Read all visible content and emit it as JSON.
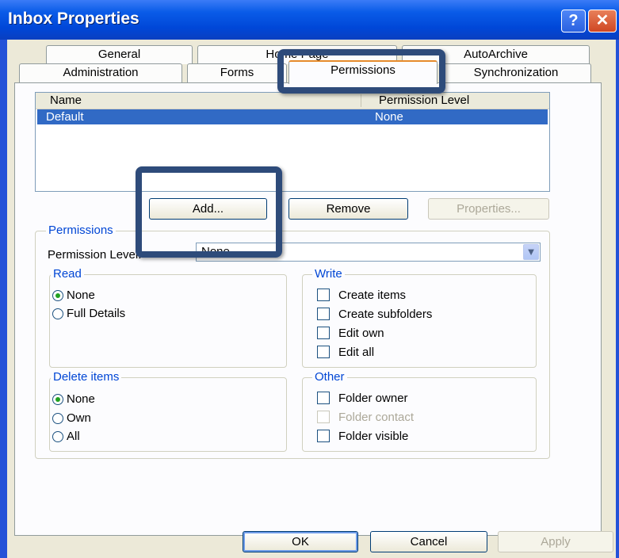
{
  "window": {
    "title": "Inbox Properties",
    "help_label": "?",
    "close_label": "✕"
  },
  "tabs": {
    "row1": [
      {
        "label": "General"
      },
      {
        "label": "Home Page"
      },
      {
        "label": "AutoArchive"
      }
    ],
    "row2": [
      {
        "label": "Administration"
      },
      {
        "label": "Forms"
      },
      {
        "label": "Permissions",
        "active": true
      },
      {
        "label": "Synchronization"
      }
    ]
  },
  "list": {
    "columns": [
      "Name",
      "Permission Level"
    ],
    "rows": [
      {
        "name": "Default",
        "level": "None",
        "selected": true
      }
    ]
  },
  "list_buttons": {
    "add": "Add...",
    "remove": "Remove",
    "properties": "Properties..."
  },
  "permissions": {
    "group_label": "Permissions",
    "level_label": "Permission Level:",
    "level_value": "None",
    "read": {
      "label": "Read",
      "options": [
        {
          "label": "None",
          "checked": true
        },
        {
          "label": "Full Details",
          "checked": false
        }
      ]
    },
    "write": {
      "label": "Write",
      "options": [
        {
          "label": "Create items",
          "checked": false
        },
        {
          "label": "Create subfolders",
          "checked": false
        },
        {
          "label": "Edit own",
          "checked": false
        },
        {
          "label": "Edit all",
          "checked": false
        }
      ]
    },
    "delete": {
      "label": "Delete items",
      "options": [
        {
          "label": "None",
          "checked": true
        },
        {
          "label": "Own",
          "checked": false
        },
        {
          "label": "All",
          "checked": false
        }
      ]
    },
    "other": {
      "label": "Other",
      "options": [
        {
          "label": "Folder owner",
          "checked": false,
          "enabled": true
        },
        {
          "label": "Folder contact",
          "checked": false,
          "enabled": false
        },
        {
          "label": "Folder visible",
          "checked": false,
          "enabled": true
        }
      ]
    }
  },
  "dialog_buttons": {
    "ok": "OK",
    "cancel": "Cancel",
    "apply": "Apply"
  },
  "colors": {
    "title_bar": "#0a5ce8",
    "selection": "#316ac5",
    "highlight_box": "#2e4b7a",
    "group_label": "#0046d5"
  }
}
